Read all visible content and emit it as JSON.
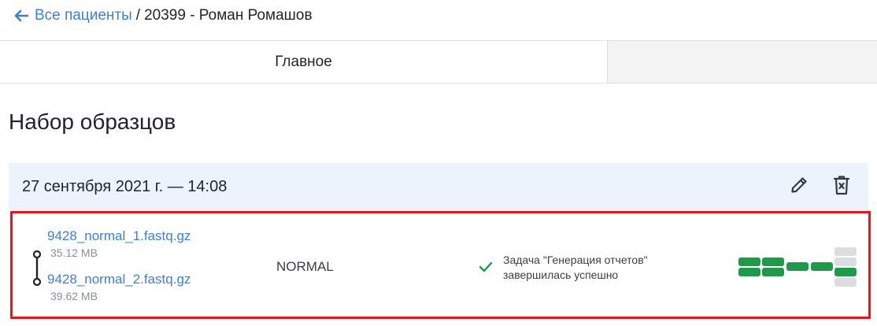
{
  "breadcrumb": {
    "back_label": "Все пациенты",
    "separator": "/",
    "current": "20399 - Роман Ромашов"
  },
  "tabs": [
    {
      "label": "Главное",
      "active": true
    }
  ],
  "section": {
    "title": "Набор образцов"
  },
  "sample_set": {
    "date_label": "27 сентября 2021 г. — 14:08",
    "files": [
      {
        "name": "9428_normal_1.fastq.gz",
        "size": "35.12 MB"
      },
      {
        "name": "9428_normal_2.fastq.gz",
        "size": "39.62 MB"
      }
    ],
    "sample_type": "NORMAL",
    "status": {
      "icon": "check-icon",
      "text": "Задача \"Генерация отчетов\" завершилась успешно"
    }
  },
  "colors": {
    "link": "#3d7fd6",
    "success": "#1e9a4a",
    "highlight_border": "#e8131b",
    "header_bg": "#edf3fc",
    "pending": "#dcdde0"
  },
  "icons": [
    "arrow-left-icon",
    "pencil-icon",
    "trash-icon",
    "check-icon"
  ]
}
